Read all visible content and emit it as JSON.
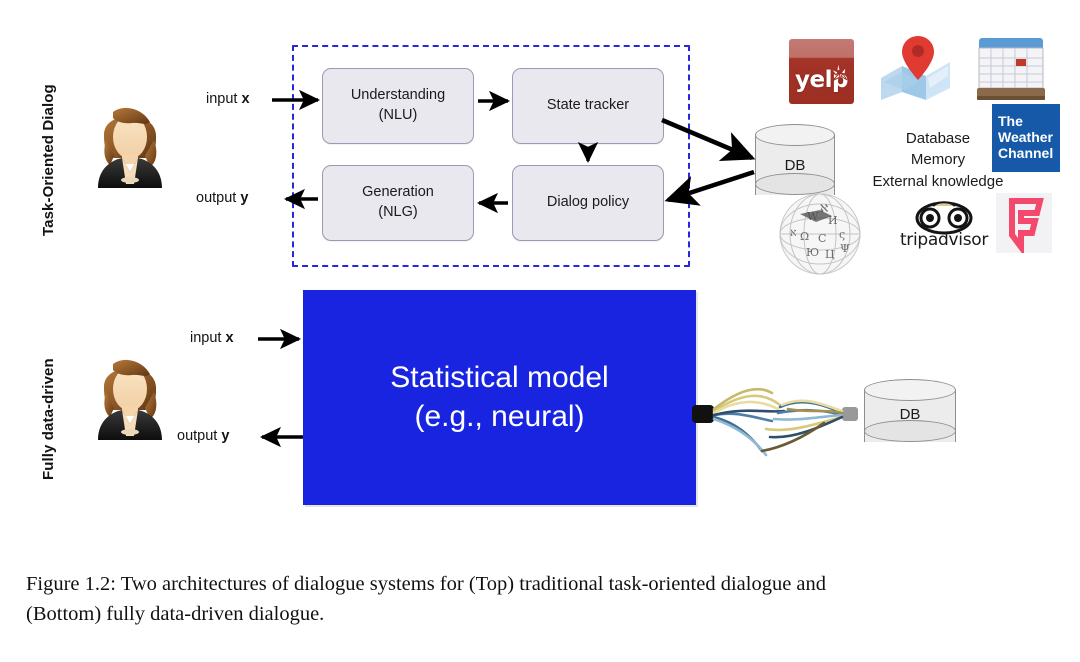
{
  "figure": {
    "caption_line1": "Figure 1.2:  Two architectures of dialogue systems for (Top) traditional task-oriented dialogue and",
    "caption_line2": "(Bottom) fully data-driven dialogue."
  },
  "sections": {
    "top_label": "Task-Oriented Dialog",
    "bottom_label": "Fully data-driven"
  },
  "top_architecture": {
    "io": {
      "input_prefix": "input ",
      "input_var": "x",
      "output_prefix": "output ",
      "output_var": "y"
    },
    "modules": [
      {
        "line1": "Understanding",
        "line2": "(NLU)"
      },
      {
        "line1": "State tracker",
        "line2": ""
      },
      {
        "line1": "Generation",
        "line2": "(NLG)"
      },
      {
        "line1": "Dialog policy",
        "line2": ""
      }
    ],
    "database_label": "DB"
  },
  "bottom_architecture": {
    "io": {
      "input_prefix": "input ",
      "input_var": "x",
      "output_prefix": "output ",
      "output_var": "y"
    },
    "model_line1": "Statistical model",
    "model_line2": "(e.g., neural)",
    "database_label": "DB"
  },
  "knowledge_sources": {
    "lines": [
      "Database",
      "Memory",
      "External knowledge"
    ],
    "logos": [
      {
        "name": "yelp",
        "text": "yelp"
      },
      {
        "name": "google-maps",
        "text": ""
      },
      {
        "name": "calendar",
        "text": ""
      },
      {
        "name": "the-weather-channel",
        "line1": "The",
        "line2": "Weather",
        "line3": "Channel"
      },
      {
        "name": "wikipedia",
        "text": ""
      },
      {
        "name": "tripadvisor",
        "text": "tripadvisor"
      },
      {
        "name": "foursquare",
        "text": ""
      }
    ]
  },
  "colors": {
    "dashed_border": "#2727DE",
    "statistical_model_bg": "#1824E0",
    "module_bg": "#E8E8EE",
    "module_border": "#9A9AB4",
    "yelp_red": "#A43328",
    "weather_blue": "#1559A8",
    "foursquare_pink": "#F3496C",
    "arrow_black": "#000000"
  }
}
